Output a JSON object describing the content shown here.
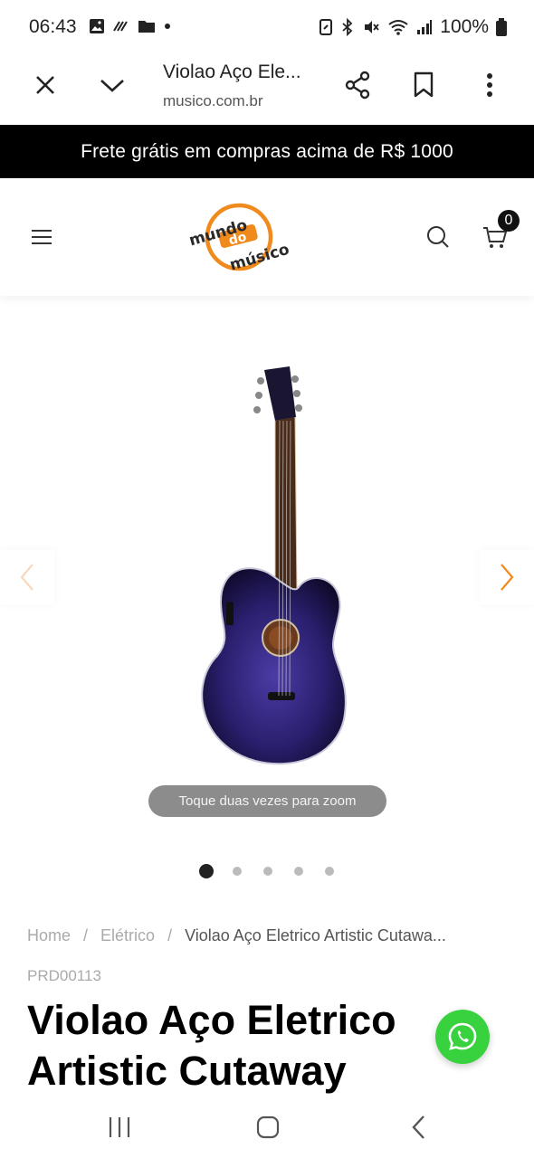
{
  "status": {
    "time": "06:43",
    "battery": "100%"
  },
  "browser": {
    "tab_title": "Violao Aço Ele...",
    "url": "musico.com.br"
  },
  "announcement": "Frete grátis em compras acima de R$ 1000",
  "header": {
    "logo_alt": "mundo do músico",
    "cart_count": "0"
  },
  "gallery": {
    "zoom_hint": "Toque duas vezes para zoom",
    "total_images": 5,
    "active_index": 0
  },
  "breadcrumb": {
    "items": [
      "Home",
      "Elétrico",
      "Violao Aço Eletrico Artistic Cutawa..."
    ]
  },
  "product": {
    "sku": "PRD00113",
    "title": "Violao Aço Eletrico Artistic Cutaway"
  },
  "colors": {
    "brand_orange": "#f08a1c",
    "accent_purple": "#3a2d8c",
    "whatsapp_green": "#38d23f"
  },
  "icons": {
    "close": "close-icon",
    "collapse": "chevron-down-icon",
    "share": "share-icon",
    "bookmark": "bookmark-icon",
    "menu": "more-vert-icon",
    "hamburger": "hamburger-icon",
    "search": "search-icon",
    "cart": "cart-icon",
    "whatsapp": "whatsapp-icon"
  }
}
